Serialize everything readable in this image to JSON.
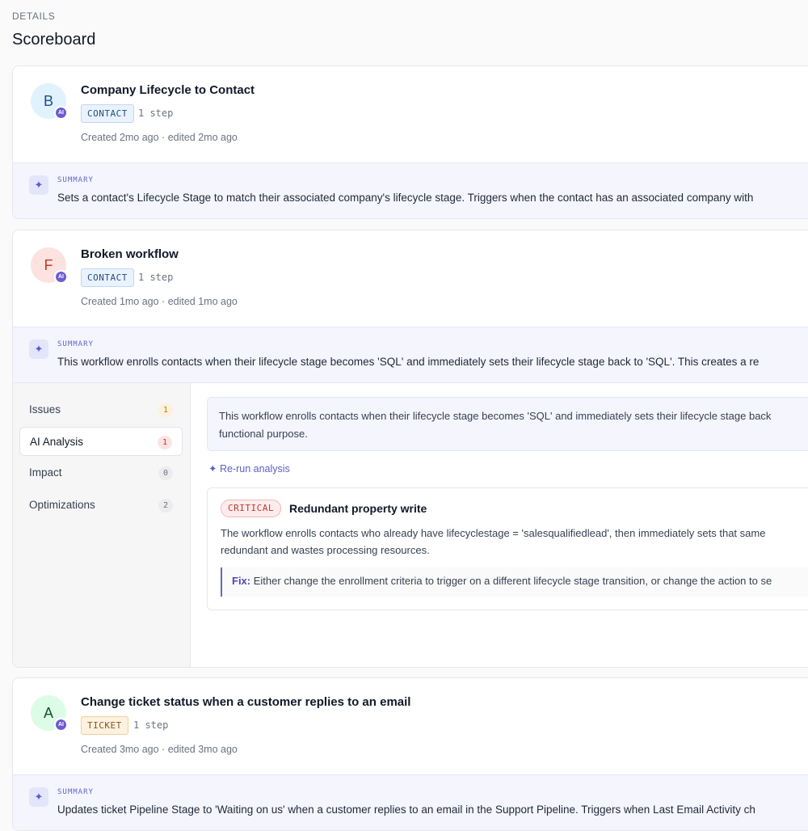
{
  "header": {
    "eyebrow": "DETAILS",
    "title": "Scoreboard"
  },
  "summary_label": "SUMMARY",
  "ai_badge": "AI",
  "workflows": [
    {
      "initial": "B",
      "title": "Company Lifecycle to Contact",
      "object": "CONTACT",
      "steps": "1 step",
      "meta": "Created 2mo ago · edited 2mo ago",
      "summary": "Sets a contact's Lifecycle Stage to match their associated company's lifecycle stage. Triggers when the contact has an associated company with",
      "avatar_bg": "#e0f2fe",
      "avatar_fg": "#1e4f8a"
    },
    {
      "initial": "F",
      "title": "Broken workflow",
      "object": "CONTACT",
      "steps": "1 step",
      "meta": "Created 1mo ago · edited 1mo ago",
      "summary": "This workflow enrolls contacts when their lifecycle stage becomes 'SQL' and immediately sets their lifecycle stage back to 'SQL'. This creates a re",
      "avatar_bg": "#fde2e0",
      "avatar_fg": "#c0392b"
    },
    {
      "initial": "A",
      "title": "Change ticket status when a customer replies to an email",
      "object": "TICKET",
      "steps": "1 step",
      "meta": "Created 3mo ago · edited 3mo ago",
      "summary": "Updates ticket Pipeline Stage to 'Waiting on us' when a customer replies to an email in the Support Pipeline. Triggers when Last Email Activity ch",
      "avatar_bg": "#dcfce7",
      "avatar_fg": "#14532d"
    }
  ],
  "analysis": {
    "tabs": [
      {
        "label": "Issues",
        "count": "1"
      },
      {
        "label": "AI Analysis",
        "count": "1"
      },
      {
        "label": "Impact",
        "count": "0"
      },
      {
        "label": "Optimizations",
        "count": "2"
      }
    ],
    "active_tab": "AI Analysis",
    "ai_summary_line1": "This workflow enrolls contacts when their lifecycle stage becomes 'SQL' and immediately sets their lifecycle stage back",
    "ai_summary_line2": "functional purpose.",
    "rerun_label": "Re-run analysis",
    "finding": {
      "severity": "CRITICAL",
      "title": "Redundant property write",
      "desc_line1": "The workflow enrolls contacts who already have lifecyclestage = 'salesqualifiedlead', then immediately sets that same",
      "desc_line2": "redundant and wastes processing resources.",
      "fix_label": "Fix:",
      "fix_text": "Either change the enrollment criteria to trigger on a different lifecycle stage transition, or change the action to se"
    }
  }
}
